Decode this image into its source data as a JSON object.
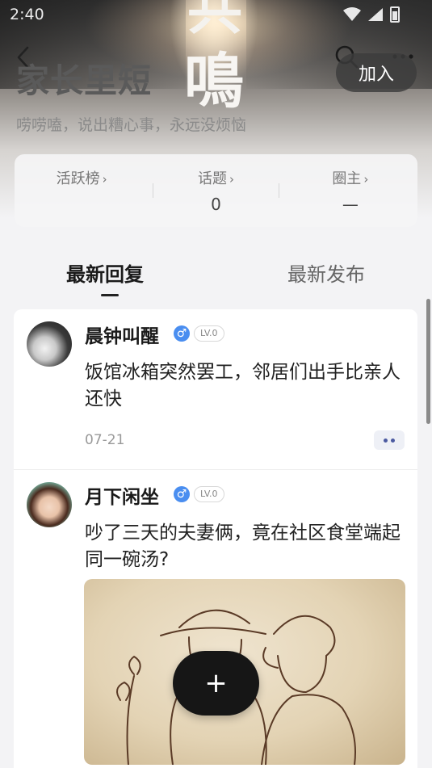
{
  "status_bar": {
    "time": "2:40"
  },
  "hero": {
    "title_char_top": "共",
    "title_char": "鳴"
  },
  "circle": {
    "name": "家长里短",
    "description": "唠唠嗑，说出糟心事，永远没烦恼",
    "join_label": "加入"
  },
  "stats": [
    {
      "label": "活跃榜",
      "value": ""
    },
    {
      "label": "话题",
      "value": "0"
    },
    {
      "label": "圈主",
      "value": "—"
    }
  ],
  "tabs": [
    {
      "label": "最新回复",
      "active": true
    },
    {
      "label": "最新发布",
      "active": false
    }
  ],
  "posts": [
    {
      "username": "晨钟叫醒",
      "gender_symbol": "♂",
      "level": "LV.0",
      "text": "饭馆冰箱突然罢工，邻居们出手比亲人还快",
      "date": "07-21"
    },
    {
      "username": "月下闲坐",
      "gender_symbol": "♂",
      "level": "LV.0",
      "text": "吵了三天的夫妻俩，竟在社区食堂端起同一碗汤?",
      "has_image": true
    }
  ],
  "fab": {
    "symbol": "+"
  },
  "colors": {
    "accent_blue": "#4a8ef0",
    "fab_bg": "#161616",
    "more_dot": "#4b5aa0"
  },
  "icons": [
    "back-arrow-icon",
    "search-icon",
    "more-icon",
    "wifi-icon",
    "cell-signal-icon",
    "battery-icon",
    "plus-icon"
  ]
}
